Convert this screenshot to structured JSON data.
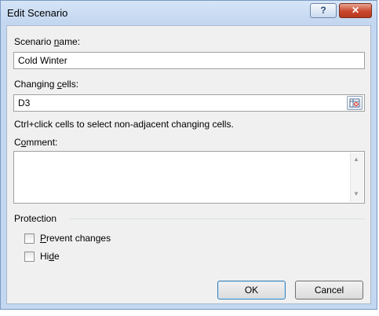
{
  "window": {
    "title": "Edit Scenario"
  },
  "titlebar": {
    "help_label": "?",
    "close_label": "✕"
  },
  "scenario_name": {
    "label_pre": "Scenario ",
    "label_ul": "n",
    "label_post": "ame:",
    "value": "Cold Winter"
  },
  "changing_cells": {
    "label_pre": "Changing ",
    "label_ul": "c",
    "label_post": "ells:",
    "value": "D3",
    "ref_icon": "range-select-icon"
  },
  "hint": "Ctrl+click cells to select non-adjacent changing cells.",
  "comment": {
    "label_pre": "C",
    "label_ul": "o",
    "label_post": "mment:",
    "value": ""
  },
  "protection": {
    "group_label": "Protection",
    "prevent_changes": {
      "label_ul": "P",
      "label_post": "revent changes",
      "checked": false
    },
    "hide": {
      "label_pre": "Hi",
      "label_ul": "d",
      "label_post": "e",
      "checked": false
    }
  },
  "buttons": {
    "ok": "OK",
    "cancel": "Cancel"
  }
}
